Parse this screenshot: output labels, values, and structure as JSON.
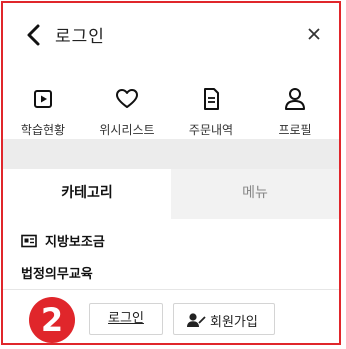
{
  "header": {
    "title": "로그인"
  },
  "quick_menu": [
    {
      "label": "학습현황",
      "icon": "play-square-icon"
    },
    {
      "label": "위시리스트",
      "icon": "heart-icon"
    },
    {
      "label": "주문내역",
      "icon": "document-icon"
    },
    {
      "label": "프로필",
      "icon": "user-icon"
    }
  ],
  "tabs": [
    {
      "label": "카테고리",
      "active": true
    },
    {
      "label": "메뉴",
      "active": false
    }
  ],
  "menu": [
    {
      "label": "지방보조금",
      "icon": "card-icon"
    },
    {
      "label": "법정의무교육"
    }
  ],
  "bottom": {
    "step_number": "2",
    "login_label": "로그인",
    "join_label": "회원가입"
  },
  "colors": {
    "accent": "#e0262b"
  }
}
